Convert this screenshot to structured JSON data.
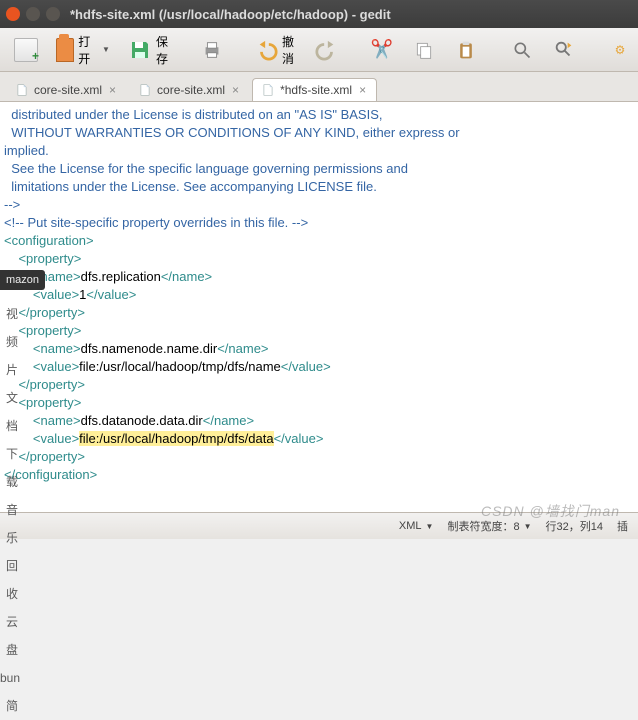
{
  "window": {
    "title": "*hdfs-site.xml (/usr/local/hadoop/etc/hadoop) - gedit"
  },
  "toolbar": {
    "open_label": "打开",
    "save_label": "保存",
    "undo_label": "撤消"
  },
  "tabs": [
    {
      "label": "core-site.xml",
      "active": false
    },
    {
      "label": "core-site.xml",
      "active": false
    },
    {
      "label": "*hdfs-site.xml",
      "active": true
    }
  ],
  "sidebar_hint": "mazon",
  "left_labels": [
    "视频",
    "片",
    "文档",
    "下载",
    "音乐",
    "回收",
    "云盘",
    "bun",
    "简"
  ],
  "statusbar": {
    "syntax": "XML",
    "tabwidth_label": "制表符宽度：8",
    "linecol": "行32，列14",
    "ins": "插"
  },
  "watermark": "CSDN @墙找门man",
  "editor_lines": [
    {
      "cls": "c-comment",
      "text": "  distributed under the License is distributed on an \"AS IS\" BASIS,"
    },
    {
      "cls": "c-comment",
      "text": "  WITHOUT WARRANTIES OR CONDITIONS OF ANY KIND, either express or"
    },
    {
      "cls": "c-comment",
      "text": "implied."
    },
    {
      "cls": "c-comment",
      "text": "  See the License for the specific language governing permissions and"
    },
    {
      "cls": "c-comment",
      "text": "  limitations under the License. See accompanying LICENSE file."
    },
    {
      "cls": "c-comment",
      "text": "-->"
    },
    {
      "cls": "c-text",
      "text": ""
    },
    {
      "cls": "c-comment",
      "text": "<!-- Put site-specific property overrides in this file. -->"
    },
    {
      "cls": "c-text",
      "text": ""
    }
  ],
  "xml_content": {
    "root_open": "<configuration>",
    "root_close": "</configuration>",
    "prop_open": "<property>",
    "prop_close": "</property>",
    "name_open": "<name>",
    "name_close": "</name>",
    "value_open": "<value>",
    "value_close": "</value>",
    "properties": [
      {
        "name": "dfs.replication",
        "value": "1",
        "value_hl": false
      },
      {
        "name": "dfs.namenode.name.dir",
        "value": "file:/usr/local/hadoop/tmp/dfs/name",
        "value_hl": false
      },
      {
        "name": "dfs.datanode.data.dir",
        "value": "file:/usr/local/hadoop/tmp/dfs/data",
        "value_hl": true
      }
    ]
  }
}
